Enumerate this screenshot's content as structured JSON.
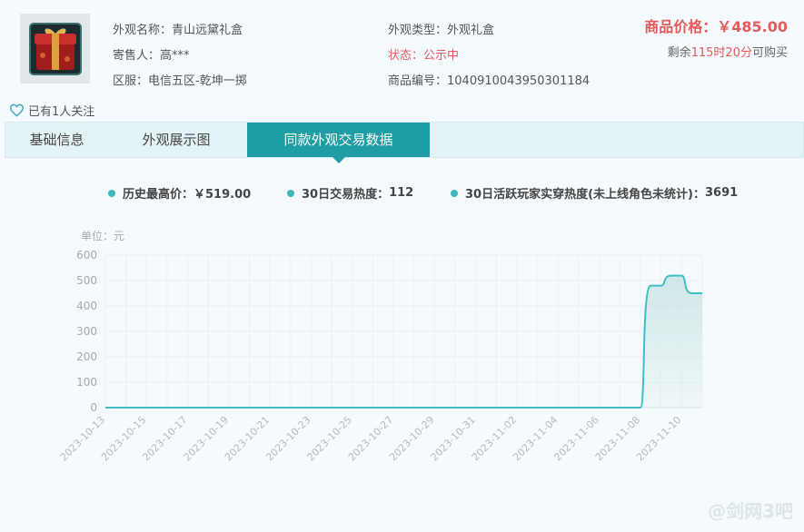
{
  "item": {
    "name_label": "外观名称：",
    "name": "青山远黛礼盒",
    "seller_label": "寄售人：",
    "seller": "高***",
    "server_label": "区服：",
    "server": "电信五区-乾坤一掷",
    "type_label": "外观类型：",
    "type": "外观礼盒",
    "status_label": "状态：",
    "status": "公示中",
    "id_label": "商品编号：",
    "id": "1040910043950301184",
    "icon": "gift-box-icon"
  },
  "price": {
    "label": "商品价格：",
    "value": "￥485.00",
    "remain_prefix": "剩余",
    "remain_hours": "115",
    "hour_unit": "时",
    "remain_minutes": "20",
    "minute_unit": "分",
    "remain_suffix": "可购买"
  },
  "follow": {
    "text": "已有1人关注",
    "icon": "heart-outline-icon"
  },
  "tabs": [
    {
      "label": "基础信息",
      "active": false
    },
    {
      "label": "外观展示图",
      "active": false
    },
    {
      "label": "同款外观交易数据",
      "active": true
    }
  ],
  "stats": [
    {
      "label": "历史最高价：",
      "value": "￥519.00"
    },
    {
      "label": "30日交易热度：",
      "value": "112"
    },
    {
      "label": "30日活跃玩家实穿热度(未上线角色未统计)：",
      "value": "3691"
    }
  ],
  "watermark": "@剑网3吧",
  "colors": {
    "accent": "#1e9ea4",
    "price_red": "#e55a5a",
    "line": "#3dbfc4",
    "area": "#cfe6e6",
    "dot": "#41b6bb"
  },
  "chart_data": {
    "type": "area",
    "unit_label": "单位：元",
    "ylim": [
      0,
      600
    ],
    "yticks": [
      0,
      100,
      200,
      300,
      400,
      500,
      600
    ],
    "x_tick_labels": [
      "2023-10-13",
      "2023-10-15",
      "2023-10-17",
      "2023-10-19",
      "2023-10-21",
      "2023-10-23",
      "2023-10-25",
      "2023-10-27",
      "2023-10-29",
      "2023-10-31",
      "2023-11-02",
      "2023-11-04",
      "2023-11-06",
      "2023-11-08",
      "2023-11-10"
    ],
    "x_start": "2023-10-13",
    "x_end": "2023-11-11",
    "grid": true,
    "series": [
      {
        "values": [
          [
            "2023-10-13",
            0
          ],
          [
            "2023-11-08",
            0
          ],
          [
            "2023-11-09",
            480
          ],
          [
            "2023-11-10",
            519
          ],
          [
            "2023-11-11",
            450
          ]
        ]
      }
    ]
  }
}
